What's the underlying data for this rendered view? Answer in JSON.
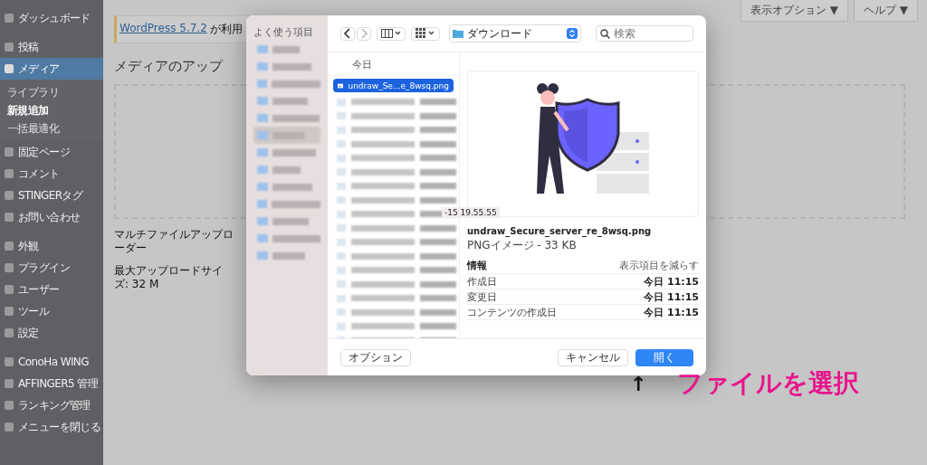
{
  "sidebar": {
    "groups": [
      {
        "items": [
          {
            "label": "ダッシュボード",
            "selected": false
          }
        ]
      },
      {
        "items": [
          {
            "label": "投稿",
            "selected": false
          },
          {
            "label": "メディア",
            "selected": true,
            "submenu": [
              {
                "label": "ライブラリ",
                "selected": false
              },
              {
                "label": "新規追加",
                "selected": true
              },
              {
                "label": "一括最適化",
                "selected": false
              }
            ]
          },
          {
            "label": "固定ページ",
            "selected": false
          },
          {
            "label": "コメント",
            "selected": false
          },
          {
            "label": "STINGERタグ",
            "selected": false
          },
          {
            "label": "お問い合わせ",
            "selected": false
          }
        ]
      },
      {
        "items": [
          {
            "label": "外観",
            "selected": false
          },
          {
            "label": "プラグイン",
            "selected": false
          },
          {
            "label": "ユーザー",
            "selected": false
          },
          {
            "label": "ツール",
            "selected": false
          },
          {
            "label": "設定",
            "selected": false
          }
        ]
      },
      {
        "items": [
          {
            "label": "ConoHa WING",
            "selected": false
          },
          {
            "label": "AFFINGER5 管理",
            "selected": false
          },
          {
            "label": "ランキング管理",
            "selected": false
          },
          {
            "label": "メニューを閉じる",
            "selected": false
          }
        ]
      }
    ]
  },
  "top_buttons": [
    "表示オプション ▼",
    "ヘルプ ▼"
  ],
  "notice": {
    "link": "WordPress 5.7.2",
    "text": "が利用"
  },
  "page_title": "メディアのアップ",
  "uploader_note": "マルチファイルアップローダー",
  "max_size": "最大アップロードサイズ: 32 M",
  "dialog": {
    "favorites_heading": "よく使う項目",
    "favorites": [
      {
        "selected": false
      },
      {
        "selected": false
      },
      {
        "selected": false
      },
      {
        "selected": false
      },
      {
        "selected": false
      },
      {
        "selected": true
      },
      {
        "selected": false
      },
      {
        "selected": false
      },
      {
        "selected": false
      },
      {
        "selected": false
      },
      {
        "selected": false
      },
      {
        "selected": false
      },
      {
        "selected": false
      }
    ],
    "location": "ダウンロード",
    "search": {
      "placeholder": "検索"
    },
    "list_header": "今日",
    "files": [
      {
        "name": "undraw_Se...e_8wsq.png",
        "selected": true
      }
    ],
    "tooltip": "-15 19.55.55",
    "preview": {
      "name": "undraw_Secure_server_re_8wsq.png",
      "type": "PNGイメージ - 33 KB",
      "info_heading": "情報",
      "show_less": "表示項目を減らす",
      "rows": [
        {
          "label": "作成日",
          "value": "今日 11:15"
        },
        {
          "label": "変更日",
          "value": "今日 11:15"
        },
        {
          "label": "コンテンツの作成日",
          "value": "今日 11:15"
        }
      ]
    },
    "buttons": [
      {
        "label": "オプション",
        "kind": "secondary"
      },
      {
        "label": "キャンセル",
        "kind": "secondary"
      },
      {
        "label": "開く",
        "kind": "default"
      }
    ]
  },
  "annotation": {
    "arrow": "↑",
    "text": "ファイルを選択"
  }
}
